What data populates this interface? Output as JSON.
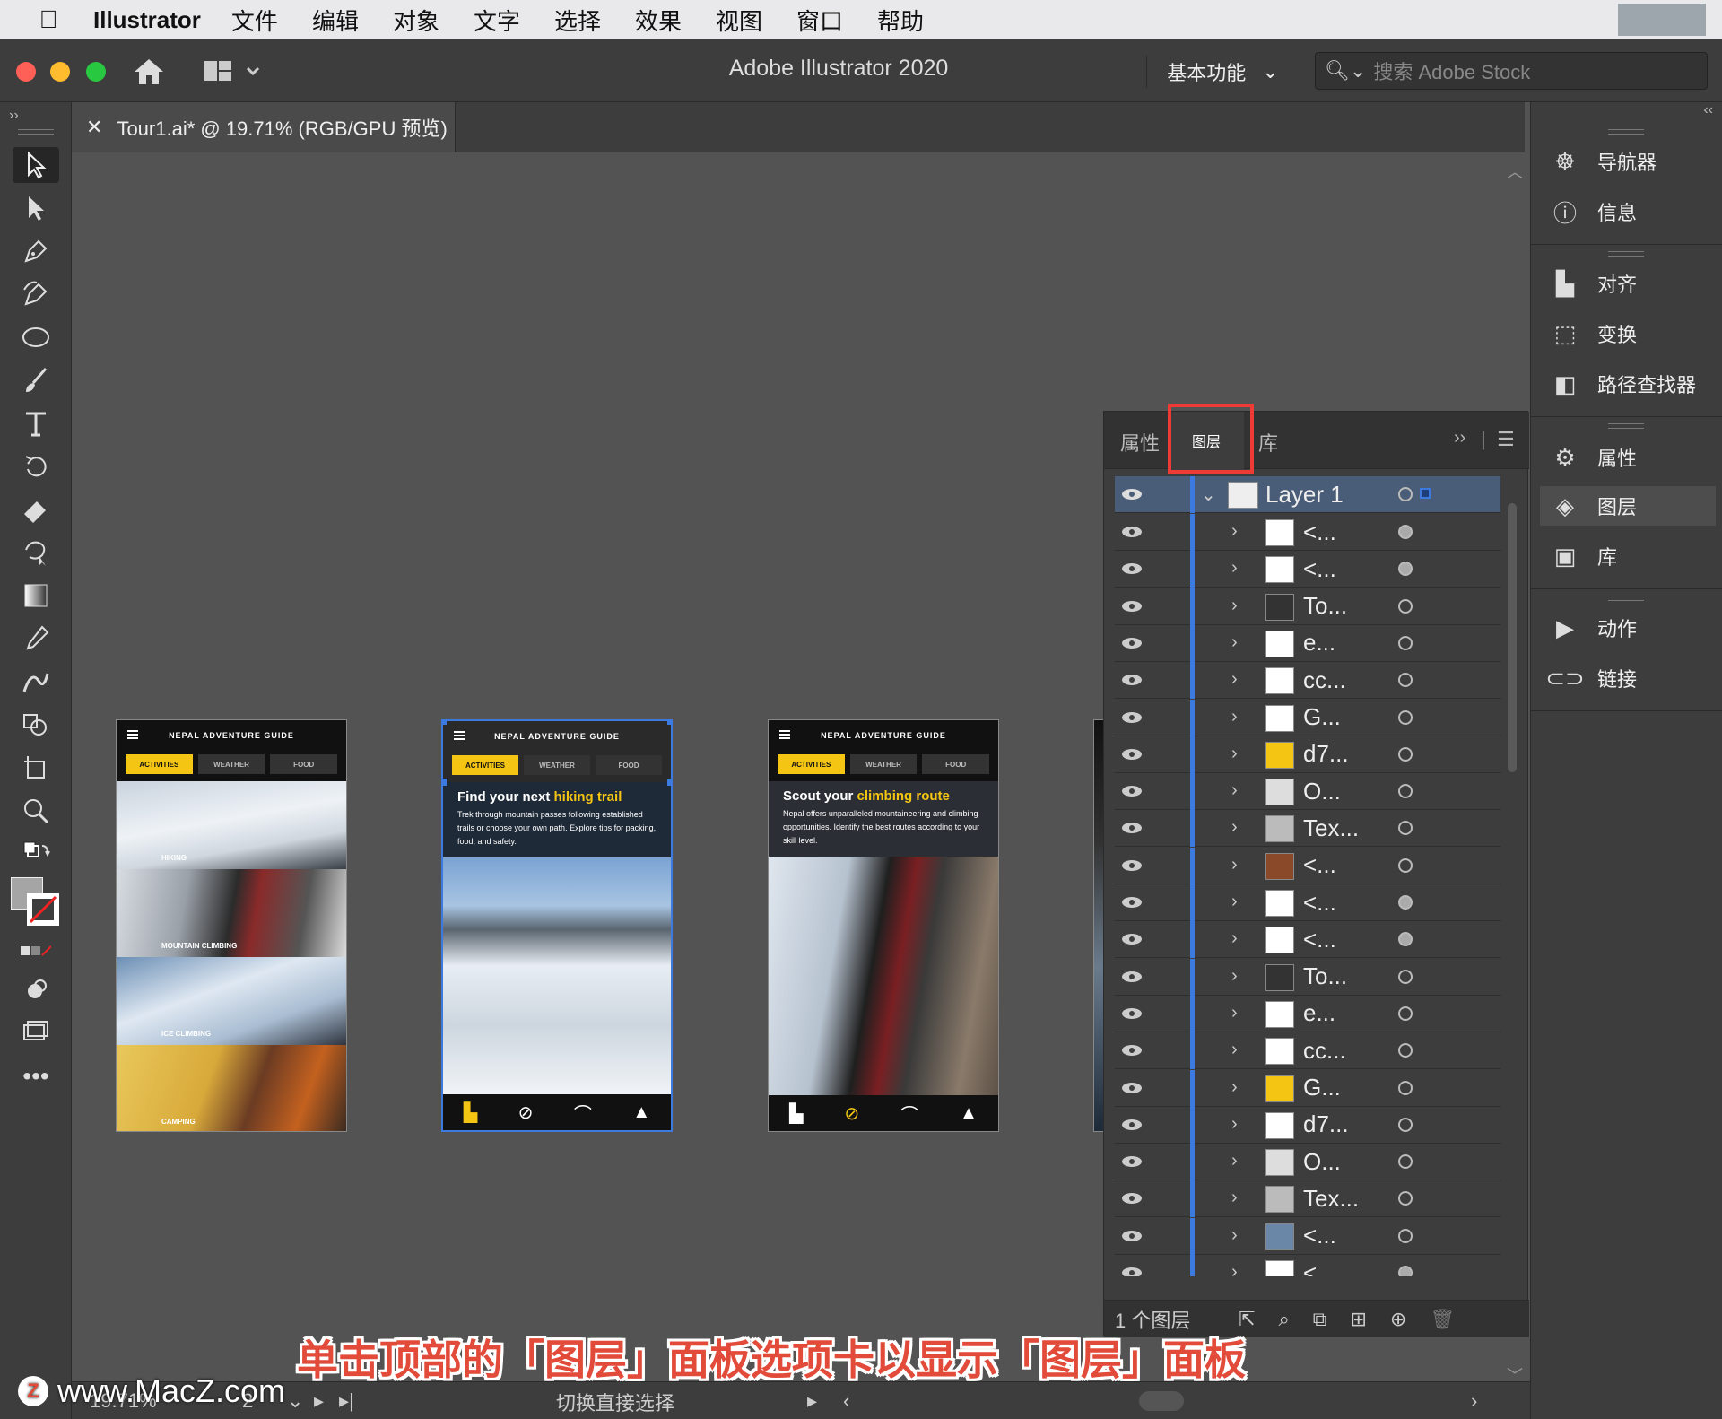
{
  "menubar": {
    "app_name": "Illustrator",
    "items": [
      "文件",
      "编辑",
      "对象",
      "文字",
      "选择",
      "效果",
      "视图",
      "窗口",
      "帮助"
    ]
  },
  "titlebar": {
    "title": "Adobe Illustrator 2020",
    "workspace": "基本功能",
    "stock_placeholder": "搜索 Adobe Stock"
  },
  "document_tab": {
    "title": "Tour1.ai* @ 19.71% (RGB/GPU 预览)"
  },
  "artboards": [
    {
      "header": "NEPAL ADVENTURE GUIDE",
      "tabs": [
        "ACTIVITIES",
        "WEATHER",
        "FOOD"
      ],
      "strips": [
        "HIKING",
        "MOUNTAIN CLIMBING",
        "ICE CLIMBING",
        "CAMPING"
      ]
    },
    {
      "header": "NEPAL ADVENTURE GUIDE",
      "tabs": [
        "ACTIVITIES",
        "WEATHER",
        "FOOD"
      ],
      "hero_title_a": "Find your next",
      "hero_title_b": "hiking trail",
      "hero_text": "Trek through mountain passes following established trails or choose your own path. Explore tips for packing, food, and safety."
    },
    {
      "header": "NEPAL ADVENTURE GUIDE",
      "tabs": [
        "ACTIVITIES",
        "WEATHER",
        "FOOD"
      ],
      "hero_title_a": "Scout your",
      "hero_title_b": "climbing route",
      "hero_text": "Nepal offers unparalleled mountaineering and climbing opportunities. Identify the best routes according to your skill level."
    }
  ],
  "layers_panel": {
    "tabs": [
      "属性",
      "图层",
      "库"
    ],
    "active_tab": "图层",
    "top_layer": "Layer 1",
    "sublayers": [
      "<...",
      "<...",
      "To...",
      "e...",
      "cc...",
      "G...",
      "d7...",
      "O...",
      "Tex...",
      "<...",
      "<...",
      "<...",
      "To...",
      "e...",
      "cc...",
      "G...",
      "d7...",
      "O...",
      "Tex...",
      "<...",
      "<..."
    ],
    "footer_count": "1 个图层"
  },
  "right_dock": {
    "items": [
      "导航器",
      "信息",
      "对齐",
      "变换",
      "路径查找器",
      "属性",
      "图层",
      "库",
      "动作",
      "链接"
    ],
    "selected": "图层"
  },
  "statusbar": {
    "zoom": "19.71%",
    "page": "2",
    "status_text": "切换直接选择"
  },
  "caption": "单击顶部的「图层」面板选项卡以显示「图层」面板",
  "watermark": "www.MacZ.com",
  "colors": {
    "accent_blue": "#3d7ae0",
    "highlight_red": "#ef3b36",
    "artboard_yellow": "#f4c513"
  }
}
